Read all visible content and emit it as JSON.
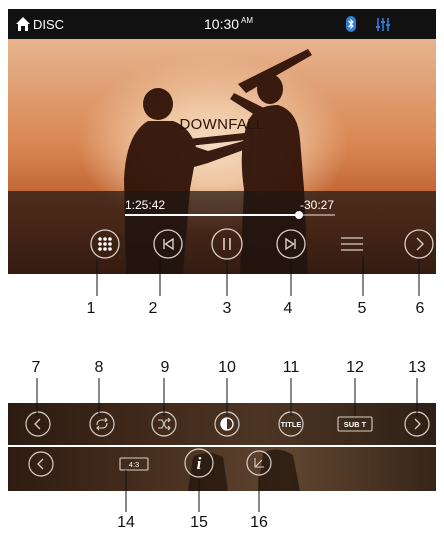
{
  "status": {
    "source": "DISC",
    "time": "10:30",
    "ampm": "AM",
    "icons": [
      "home-icon",
      "bluetooth-icon",
      "equalizer-icon"
    ]
  },
  "player": {
    "title": "DOWNFALL",
    "elapsed": "1:25:42",
    "remaining": "-30:27",
    "progress_fraction": 0.83
  },
  "row1_controls": [
    "menu-grid-icon",
    "previous-icon",
    "pause-icon",
    "next-icon",
    "list-icon",
    "chevron-right-icon"
  ],
  "row2_controls": [
    "chevron-left-icon",
    "repeat-icon",
    "shuffle-icon",
    "contrast-icon",
    "title-icon",
    "subtitle-icon",
    "chevron-right-icon"
  ],
  "row3_controls": [
    "chevron-left-icon",
    "aspect-ratio-icon",
    "info-icon",
    "angle-icon"
  ],
  "labels": {
    "title_button": "TITLE",
    "subtitle_button": "SUB T",
    "aspect_button": "4:3",
    "info_button": "i"
  },
  "callouts": {
    "row1": [
      "1",
      "2",
      "3",
      "4",
      "5",
      "6"
    ],
    "row2": [
      "7",
      "8",
      "9",
      "10",
      "11",
      "12",
      "13"
    ],
    "row3": [
      "14",
      "15",
      "16"
    ]
  },
  "colors": {
    "accent_blue": "#2f7fd8",
    "bar_bg": "#111111",
    "control_outline": "#d8d0c8"
  }
}
